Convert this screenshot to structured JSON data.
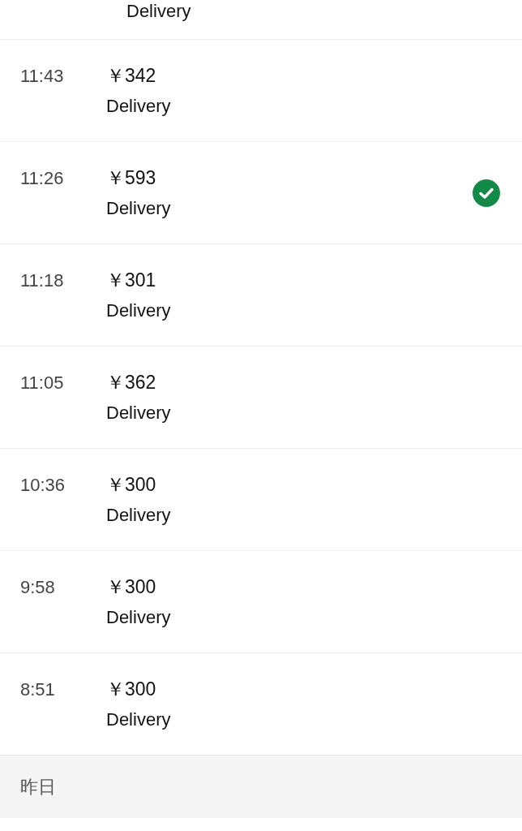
{
  "top_row": {
    "type": "Delivery"
  },
  "rows": [
    {
      "time": "11:43",
      "amount": "￥342",
      "type": "Delivery",
      "checked": false
    },
    {
      "time": "11:26",
      "amount": "￥593",
      "type": "Delivery",
      "checked": true
    },
    {
      "time": "11:18",
      "amount": "￥301",
      "type": "Delivery",
      "checked": false
    },
    {
      "time": "11:05",
      "amount": "￥362",
      "type": "Delivery",
      "checked": false
    },
    {
      "time": "10:36",
      "amount": "￥300",
      "type": "Delivery",
      "checked": false
    },
    {
      "time": "9:58",
      "amount": "￥300",
      "type": "Delivery",
      "checked": false
    },
    {
      "time": "8:51",
      "amount": "￥300",
      "type": "Delivery",
      "checked": false
    }
  ],
  "section_header": {
    "label": "昨日"
  }
}
